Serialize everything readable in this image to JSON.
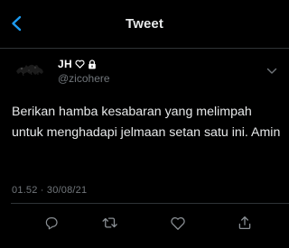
{
  "header": {
    "title": "Tweet",
    "back_icon": "back-arrow-icon"
  },
  "author": {
    "display_name": "JH",
    "name_icons": [
      "heart-outline-icon",
      "lock-icon"
    ],
    "handle": "@zicohere",
    "more_icon": "chevron-down-icon"
  },
  "tweet": {
    "text": "Berikan hamba kesabaran yang melimpah untuk menghadapi jelmaan setan satu ini. Amin",
    "timestamp": "01.52 · 30/08/21"
  },
  "actions": {
    "icons": [
      "reply-icon",
      "retweet-icon",
      "like-icon",
      "share-icon"
    ]
  },
  "colors": {
    "background": "#000000",
    "text_primary": "#e7e9ea",
    "text_secondary": "#71767b",
    "accent": "#1d9bf0",
    "divider": "#2f3336"
  }
}
